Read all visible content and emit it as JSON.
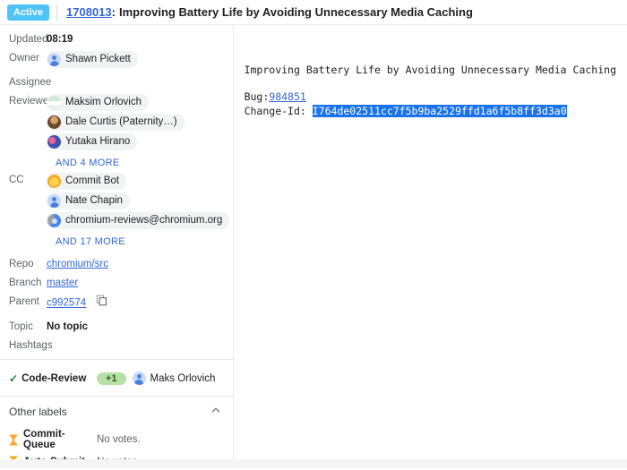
{
  "header": {
    "status": "Active",
    "change_number": "1708013",
    "colon": ":",
    "title": "Improving Battery Life by Avoiding Unnecessary Media Caching"
  },
  "metadata": {
    "updated": {
      "label": "Updated",
      "value": "08:19"
    },
    "owner": {
      "label": "Owner",
      "name": "Shawn Pickett",
      "avatar": "default-avatar-icon"
    },
    "assignee": {
      "label": "Assignee",
      "value": ""
    },
    "reviewers": {
      "label": "Reviewers",
      "items": [
        {
          "name": "Maksim Orlovich",
          "avatar": "green-avatar-icon"
        },
        {
          "name": "Dale Curtis (Paternity…)",
          "avatar": "photo-avatar-icon"
        },
        {
          "name": "Yutaka Hirano",
          "avatar": "blue-pink-avatar-icon"
        }
      ],
      "more": "AND 4 MORE"
    },
    "cc": {
      "label": "CC",
      "items": [
        {
          "name": "Commit Bot",
          "avatar": "commit-bot-avatar-icon"
        },
        {
          "name": "Nate Chapin",
          "avatar": "default-avatar-icon"
        },
        {
          "name": "chromium-reviews@chromium.org",
          "avatar": "chromium-avatar-icon"
        }
      ],
      "more": "AND 17 MORE"
    },
    "repo": {
      "label": "Repo",
      "value": "chromium/src"
    },
    "branch": {
      "label": "Branch",
      "value": "master"
    },
    "parent": {
      "label": "Parent",
      "value": "c992574",
      "copy_icon": "copy-icon"
    },
    "topic": {
      "label": "Topic",
      "value": "No topic"
    },
    "hashtags": {
      "label": "Hashtags",
      "value": ""
    }
  },
  "labels": {
    "code_review": {
      "name": "Code-Review",
      "status_icon": "check-icon",
      "vote": "+1",
      "voter": "Maks Orlovich",
      "voter_avatar": "default-avatar-icon"
    },
    "other_labels_title": "Other labels",
    "collapse_icon": "chevron-up-icon",
    "rows": [
      {
        "name": "Commit-Queue",
        "icon": "hourglass-icon",
        "votes": "No votes."
      },
      {
        "name": "Auto-Submit",
        "icon": "hourglass-icon",
        "votes": "No votes."
      }
    ]
  },
  "commit_message": {
    "subject": "Improving Battery Life by Avoiding Unnecessary Media Caching",
    "bug_label": "Bug:",
    "bug_id": "984851",
    "change_id_label": "Change-Id: ",
    "change_id_value": "I764de02511cc7f5b9ba2529ffd1a6f5b8ff3d3a0"
  },
  "colors": {
    "status_badge": "#4fc3f7",
    "link": "#3367d6",
    "selection": "#1a73e8",
    "vote_chip": "#b7e1a4",
    "check": "#188038",
    "hourglass": "#f9a825"
  }
}
